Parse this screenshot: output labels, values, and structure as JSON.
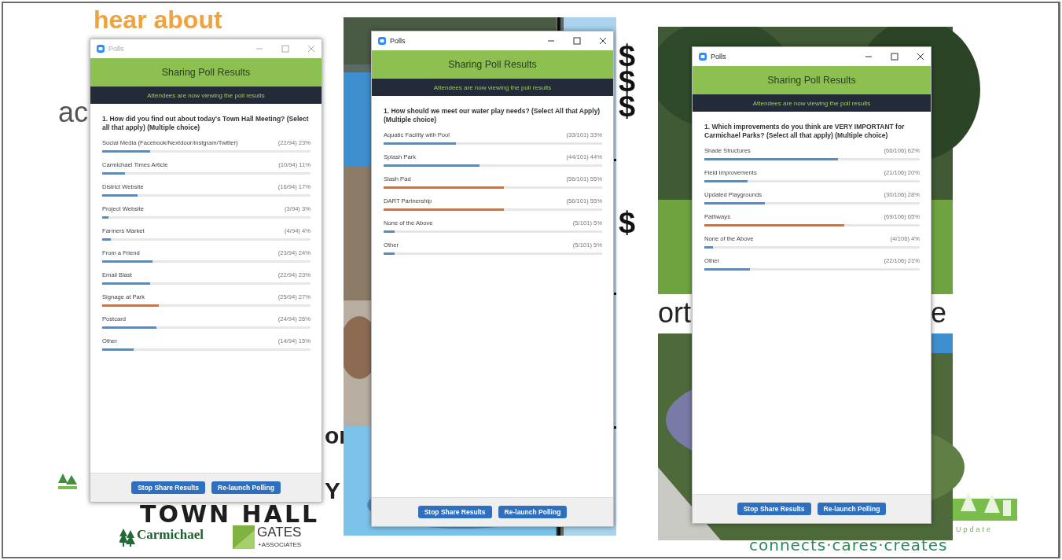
{
  "slides": [
    {
      "kind": "townhall",
      "texts": [
        {
          "kind": "headline",
          "text": "hear about"
        },
        {
          "kind": "fragment-left",
          "text": "ac"
        },
        {
          "kind": "fragment-mid",
          "text": "or"
        },
        {
          "kind": "fragment-y",
          "text": "Y"
        },
        {
          "kind": "event",
          "text": "TOWN HALL"
        },
        {
          "kind": "logo-carmichael",
          "text": "Carmichael"
        },
        {
          "kind": "logo-gates",
          "text": "GATES"
        },
        {
          "kind": "logo-gates-sub",
          "text": "+ASSOCIATES"
        }
      ],
      "poll": {
        "window_title": "Polls",
        "active": false,
        "header": "Sharing Poll Results",
        "banner": "Attendees are now viewing the poll results",
        "question": "1. How did you find out about today's Town Hall Meeting? (Select all that apply) (Multiple choice)",
        "options": [
          {
            "label": "Social Media (Facebook/Nextdoor/instgram/Twitter)",
            "count": "(22/94) 23%",
            "level": 0.23,
            "color": "#4a8fd1"
          },
          {
            "label": "Carmichael Times Article",
            "count": "(10/94) 11%",
            "level": 0.11,
            "color": "#4a8fd1"
          },
          {
            "label": "District Website",
            "count": "(16/94) 17%",
            "level": 0.17,
            "color": "#4a8fd1"
          },
          {
            "label": "Project Website",
            "count": "(3/94) 3%",
            "level": 0.03,
            "color": "#4a8fd1"
          },
          {
            "label": "Farmers Market",
            "count": "(4/94) 4%",
            "level": 0.04,
            "color": "#4a8fd1"
          },
          {
            "label": "From a Friend",
            "count": "(23/94) 24%",
            "level": 0.24,
            "color": "#4a8fd1"
          },
          {
            "label": "Email Blast",
            "count": "(22/94) 23%",
            "level": 0.23,
            "color": "#4a8fd1"
          },
          {
            "label": "Signage at Park",
            "count": "(25/94) 27%",
            "level": 0.27,
            "color": "#e8692c"
          },
          {
            "label": "Postcard",
            "count": "(24/94) 26%",
            "level": 0.26,
            "color": "#4a8fd1"
          },
          {
            "label": "Other",
            "count": "(14/94) 15%",
            "level": 0.15,
            "color": "#4a8fd1"
          }
        ],
        "buttons": [
          "Stop Share Results",
          "Re-launch Polling"
        ]
      }
    },
    {
      "kind": "pool",
      "texts": [
        {
          "kind": "dollar",
          "text": "$"
        },
        {
          "kind": "dollar",
          "text": "$"
        },
        {
          "kind": "dollar",
          "text": "$"
        },
        {
          "kind": "dollar-big",
          "text": "$"
        }
      ],
      "poll": {
        "window_title": "Polls",
        "active": true,
        "header": "Sharing Poll Results",
        "banner": "Attendees are now viewing the poll results",
        "question": "1. How should we meet our water play needs? (Select All that Apply) (Multiple choice)",
        "options": [
          {
            "label": "Aquatic Facility with Pool",
            "count": "(33/101) 33%",
            "level": 0.33,
            "color": "#4a8fd1"
          },
          {
            "label": "Splash Park",
            "count": "(44/101) 44%",
            "level": 0.44,
            "color": "#4a8fd1"
          },
          {
            "label": "Slash Pad",
            "count": "(56/101) 55%",
            "level": 0.55,
            "color": "#e8692c"
          },
          {
            "label": "DART Partnership",
            "count": "(56/101) 55%",
            "level": 0.55,
            "color": "#e8692c"
          },
          {
            "label": "None of the Above",
            "count": "(5/101) 5%",
            "level": 0.05,
            "color": "#4a8fd1"
          },
          {
            "label": "Other",
            "count": "(5/101) 5%",
            "level": 0.05,
            "color": "#4a8fd1"
          }
        ],
        "buttons": [
          "Stop Share Results",
          "Re-launch Polling"
        ]
      }
    },
    {
      "kind": "park",
      "texts": [
        {
          "kind": "fragment-left",
          "text": "ort"
        },
        {
          "kind": "fragment-right",
          "text": "e"
        },
        {
          "kind": "update",
          "text": "Update"
        },
        {
          "kind": "tagline",
          "text": "connects·cares·creates"
        }
      ],
      "poll": {
        "window_title": "Polls",
        "active": true,
        "header": "Sharing Poll Results",
        "banner": "Attendees are now viewing the poll results",
        "question": "1. Which improvements do you think are VERY IMPORTANT for Carmichael Parks? (Select all that apply) (Multiple choice)",
        "options": [
          {
            "label": "Shade Structures",
            "count": "(66/106) 62%",
            "level": 0.62,
            "color": "#4a8fd1"
          },
          {
            "label": "Field Improvements",
            "count": "(21/106) 20%",
            "level": 0.2,
            "color": "#4a8fd1"
          },
          {
            "label": "Updated Playgrounds",
            "count": "(30/106) 28%",
            "level": 0.28,
            "color": "#4a8fd1"
          },
          {
            "label": "Pathways",
            "count": "(69/106) 65%",
            "level": 0.65,
            "color": "#e8692c"
          },
          {
            "label": "None of the Above",
            "count": "(4/106) 4%",
            "level": 0.04,
            "color": "#4a8fd1"
          },
          {
            "label": "Other",
            "count": "(22/106) 21%",
            "level": 0.21,
            "color": "#4a8fd1"
          }
        ],
        "buttons": [
          "Stop Share Results",
          "Re-launch Polling"
        ]
      }
    }
  ]
}
